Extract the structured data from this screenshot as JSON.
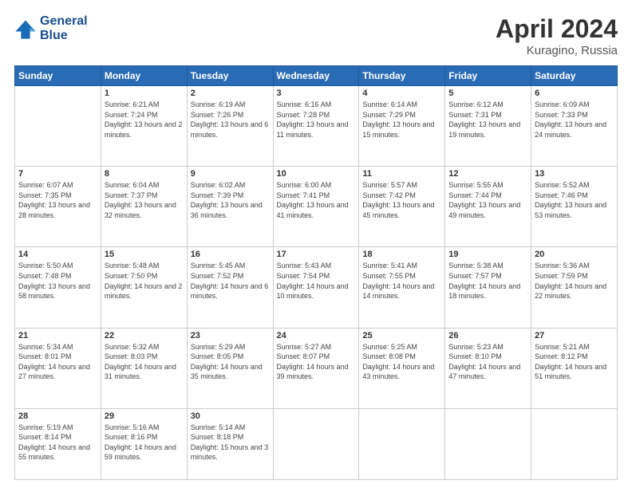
{
  "header": {
    "logo_line1": "General",
    "logo_line2": "Blue",
    "title": "April 2024",
    "location": "Kuragino, Russia"
  },
  "weekdays": [
    "Sunday",
    "Monday",
    "Tuesday",
    "Wednesday",
    "Thursday",
    "Friday",
    "Saturday"
  ],
  "weeks": [
    [
      {
        "day": "",
        "sunrise": "",
        "sunset": "",
        "daylight": ""
      },
      {
        "day": "1",
        "sunrise": "Sunrise: 6:21 AM",
        "sunset": "Sunset: 7:24 PM",
        "daylight": "Daylight: 13 hours and 2 minutes."
      },
      {
        "day": "2",
        "sunrise": "Sunrise: 6:19 AM",
        "sunset": "Sunset: 7:26 PM",
        "daylight": "Daylight: 13 hours and 6 minutes."
      },
      {
        "day": "3",
        "sunrise": "Sunrise: 6:16 AM",
        "sunset": "Sunset: 7:28 PM",
        "daylight": "Daylight: 13 hours and 11 minutes."
      },
      {
        "day": "4",
        "sunrise": "Sunrise: 6:14 AM",
        "sunset": "Sunset: 7:29 PM",
        "daylight": "Daylight: 13 hours and 15 minutes."
      },
      {
        "day": "5",
        "sunrise": "Sunrise: 6:12 AM",
        "sunset": "Sunset: 7:31 PM",
        "daylight": "Daylight: 13 hours and 19 minutes."
      },
      {
        "day": "6",
        "sunrise": "Sunrise: 6:09 AM",
        "sunset": "Sunset: 7:33 PM",
        "daylight": "Daylight: 13 hours and 24 minutes."
      }
    ],
    [
      {
        "day": "7",
        "sunrise": "Sunrise: 6:07 AM",
        "sunset": "Sunset: 7:35 PM",
        "daylight": "Daylight: 13 hours and 28 minutes."
      },
      {
        "day": "8",
        "sunrise": "Sunrise: 6:04 AM",
        "sunset": "Sunset: 7:37 PM",
        "daylight": "Daylight: 13 hours and 32 minutes."
      },
      {
        "day": "9",
        "sunrise": "Sunrise: 6:02 AM",
        "sunset": "Sunset: 7:39 PM",
        "daylight": "Daylight: 13 hours and 36 minutes."
      },
      {
        "day": "10",
        "sunrise": "Sunrise: 6:00 AM",
        "sunset": "Sunset: 7:41 PM",
        "daylight": "Daylight: 13 hours and 41 minutes."
      },
      {
        "day": "11",
        "sunrise": "Sunrise: 5:57 AM",
        "sunset": "Sunset: 7:42 PM",
        "daylight": "Daylight: 13 hours and 45 minutes."
      },
      {
        "day": "12",
        "sunrise": "Sunrise: 5:55 AM",
        "sunset": "Sunset: 7:44 PM",
        "daylight": "Daylight: 13 hours and 49 minutes."
      },
      {
        "day": "13",
        "sunrise": "Sunrise: 5:52 AM",
        "sunset": "Sunset: 7:46 PM",
        "daylight": "Daylight: 13 hours and 53 minutes."
      }
    ],
    [
      {
        "day": "14",
        "sunrise": "Sunrise: 5:50 AM",
        "sunset": "Sunset: 7:48 PM",
        "daylight": "Daylight: 13 hours and 58 minutes."
      },
      {
        "day": "15",
        "sunrise": "Sunrise: 5:48 AM",
        "sunset": "Sunset: 7:50 PM",
        "daylight": "Daylight: 14 hours and 2 minutes."
      },
      {
        "day": "16",
        "sunrise": "Sunrise: 5:45 AM",
        "sunset": "Sunset: 7:52 PM",
        "daylight": "Daylight: 14 hours and 6 minutes."
      },
      {
        "day": "17",
        "sunrise": "Sunrise: 5:43 AM",
        "sunset": "Sunset: 7:54 PM",
        "daylight": "Daylight: 14 hours and 10 minutes."
      },
      {
        "day": "18",
        "sunrise": "Sunrise: 5:41 AM",
        "sunset": "Sunset: 7:55 PM",
        "daylight": "Daylight: 14 hours and 14 minutes."
      },
      {
        "day": "19",
        "sunrise": "Sunrise: 5:38 AM",
        "sunset": "Sunset: 7:57 PM",
        "daylight": "Daylight: 14 hours and 18 minutes."
      },
      {
        "day": "20",
        "sunrise": "Sunrise: 5:36 AM",
        "sunset": "Sunset: 7:59 PM",
        "daylight": "Daylight: 14 hours and 22 minutes."
      }
    ],
    [
      {
        "day": "21",
        "sunrise": "Sunrise: 5:34 AM",
        "sunset": "Sunset: 8:01 PM",
        "daylight": "Daylight: 14 hours and 27 minutes."
      },
      {
        "day": "22",
        "sunrise": "Sunrise: 5:32 AM",
        "sunset": "Sunset: 8:03 PM",
        "daylight": "Daylight: 14 hours and 31 minutes."
      },
      {
        "day": "23",
        "sunrise": "Sunrise: 5:29 AM",
        "sunset": "Sunset: 8:05 PM",
        "daylight": "Daylight: 14 hours and 35 minutes."
      },
      {
        "day": "24",
        "sunrise": "Sunrise: 5:27 AM",
        "sunset": "Sunset: 8:07 PM",
        "daylight": "Daylight: 14 hours and 39 minutes."
      },
      {
        "day": "25",
        "sunrise": "Sunrise: 5:25 AM",
        "sunset": "Sunset: 8:08 PM",
        "daylight": "Daylight: 14 hours and 43 minutes."
      },
      {
        "day": "26",
        "sunrise": "Sunrise: 5:23 AM",
        "sunset": "Sunset: 8:10 PM",
        "daylight": "Daylight: 14 hours and 47 minutes."
      },
      {
        "day": "27",
        "sunrise": "Sunrise: 5:21 AM",
        "sunset": "Sunset: 8:12 PM",
        "daylight": "Daylight: 14 hours and 51 minutes."
      }
    ],
    [
      {
        "day": "28",
        "sunrise": "Sunrise: 5:19 AM",
        "sunset": "Sunset: 8:14 PM",
        "daylight": "Daylight: 14 hours and 55 minutes."
      },
      {
        "day": "29",
        "sunrise": "Sunrise: 5:16 AM",
        "sunset": "Sunset: 8:16 PM",
        "daylight": "Daylight: 14 hours and 59 minutes."
      },
      {
        "day": "30",
        "sunrise": "Sunrise: 5:14 AM",
        "sunset": "Sunset: 8:18 PM",
        "daylight": "Daylight: 15 hours and 3 minutes."
      },
      {
        "day": "",
        "sunrise": "",
        "sunset": "",
        "daylight": ""
      },
      {
        "day": "",
        "sunrise": "",
        "sunset": "",
        "daylight": ""
      },
      {
        "day": "",
        "sunrise": "",
        "sunset": "",
        "daylight": ""
      },
      {
        "day": "",
        "sunrise": "",
        "sunset": "",
        "daylight": ""
      }
    ]
  ]
}
